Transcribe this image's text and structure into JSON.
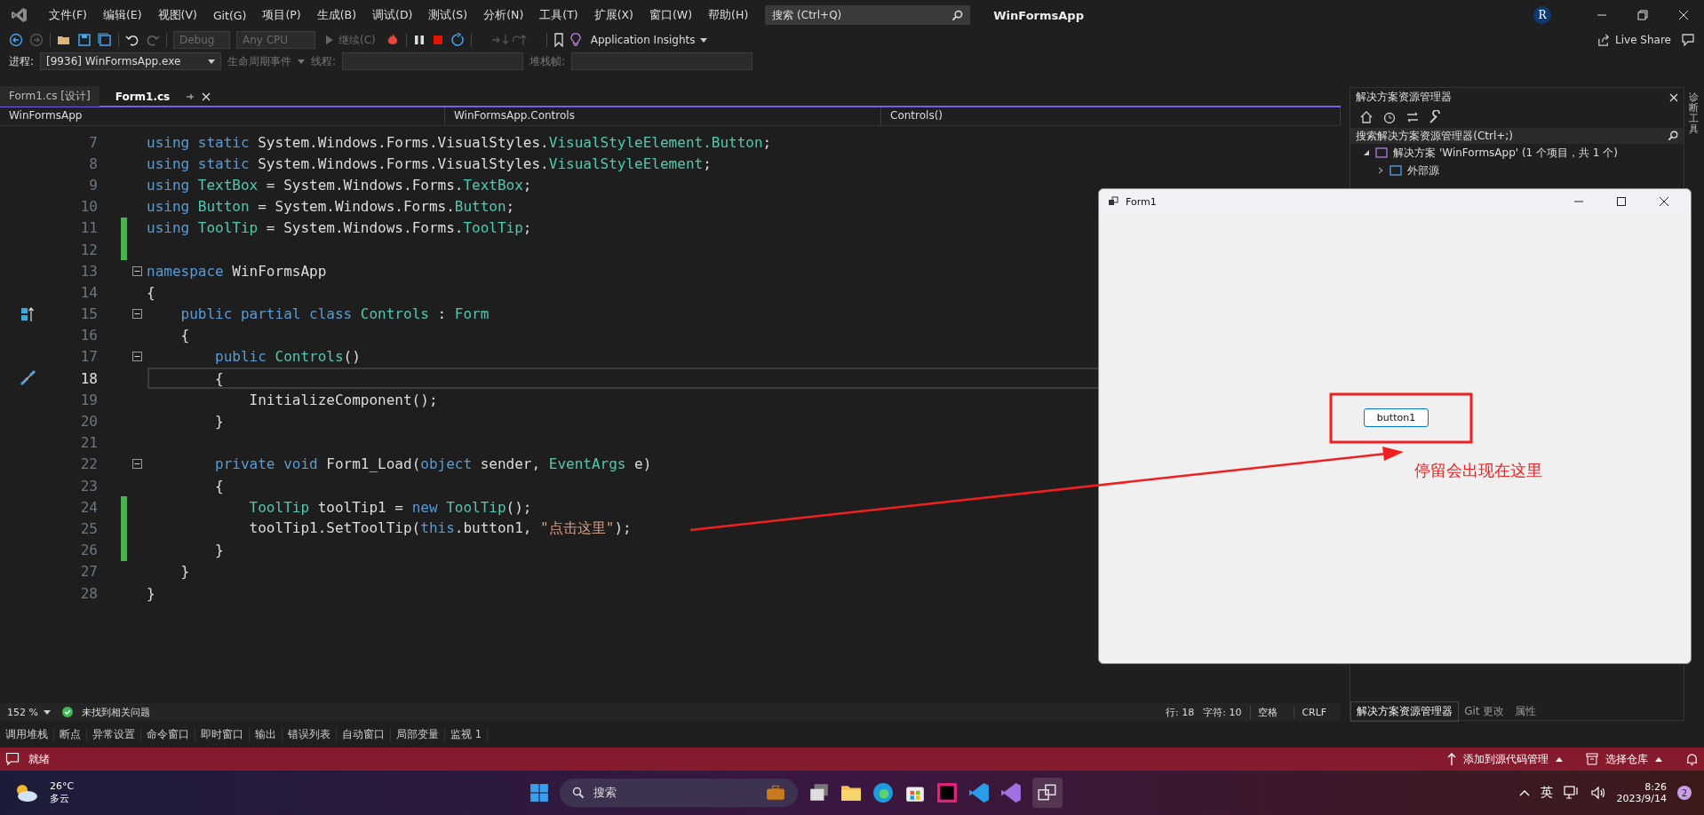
{
  "menu_bar": {
    "items": [
      "文件(F)",
      "编辑(E)",
      "视图(V)",
      "Git(G)",
      "项目(P)",
      "生成(B)",
      "调试(D)",
      "测试(S)",
      "分析(N)",
      "工具(T)",
      "扩展(X)",
      "窗口(W)",
      "帮助(H)"
    ],
    "search": {
      "placeholder": "搜索 (Ctrl+Q)"
    },
    "title": "WinFormsApp",
    "avatar": "R"
  },
  "toolbar": {
    "configuration": "Debug",
    "platform": "Any CPU",
    "continue": "继续(C)",
    "insights": "Application Insights",
    "live_share": "Live Share"
  },
  "debug_toolbar": {
    "process_label": "进程:",
    "process": "[9936] WinFormsApp.exe",
    "lifecycle": "生命周期事件",
    "thread_label": "线程:",
    "stack_label": "堆栈帧:"
  },
  "doc_tabs": [
    {
      "label": "Form1.cs [设计]",
      "selected": false
    },
    {
      "label": "Form1.cs",
      "selected": true
    }
  ],
  "nav_bar": {
    "project": "WinFormsApp",
    "type": "WinFormsApp.Controls",
    "member": "Controls()"
  },
  "code": {
    "lines": [
      {
        "number": "7",
        "changed": false,
        "fold": false,
        "current": false,
        "tokens": [
          {
            "kind": "kw",
            "text": "using static "
          },
          {
            "kind": "plain",
            "text": "System.Windows.Forms.VisualStyles."
          },
          {
            "kind": "type",
            "text": "VisualStyleElement.Button"
          },
          {
            "kind": "plain",
            "text": ";"
          }
        ]
      },
      {
        "number": "8",
        "changed": false,
        "fold": false,
        "current": false,
        "tokens": [
          {
            "kind": "kw",
            "text": "using static "
          },
          {
            "kind": "plain",
            "text": "System.Windows.Forms.VisualStyles."
          },
          {
            "kind": "type",
            "text": "VisualStyleElement"
          },
          {
            "kind": "plain",
            "text": ";"
          }
        ]
      },
      {
        "number": "9",
        "changed": false,
        "fold": false,
        "current": false,
        "tokens": [
          {
            "kind": "kw",
            "text": "using "
          },
          {
            "kind": "type",
            "text": "TextBox"
          },
          {
            "kind": "plain",
            "text": " = System.Windows.Forms."
          },
          {
            "kind": "type",
            "text": "TextBox"
          },
          {
            "kind": "plain",
            "text": ";"
          }
        ]
      },
      {
        "number": "10",
        "changed": false,
        "fold": false,
        "current": false,
        "tokens": [
          {
            "kind": "kw",
            "text": "using "
          },
          {
            "kind": "type",
            "text": "Button"
          },
          {
            "kind": "plain",
            "text": " = System.Windows.Forms."
          },
          {
            "kind": "type",
            "text": "Button"
          },
          {
            "kind": "plain",
            "text": ";"
          }
        ]
      },
      {
        "number": "11",
        "changed": true,
        "fold": false,
        "current": false,
        "tokens": [
          {
            "kind": "kw",
            "text": "using "
          },
          {
            "kind": "type",
            "text": "ToolTip"
          },
          {
            "kind": "plain",
            "text": " = System.Windows.Forms."
          },
          {
            "kind": "type",
            "text": "ToolTip"
          },
          {
            "kind": "plain",
            "text": ";"
          }
        ]
      },
      {
        "number": "12",
        "changed": true,
        "fold": false,
        "current": false
      },
      {
        "number": "13",
        "changed": false,
        "fold": true,
        "current": false,
        "tokens": [
          {
            "kind": "kw",
            "text": "namespace"
          },
          {
            "kind": "plain",
            "text": " WinFormsApp"
          }
        ]
      },
      {
        "number": "14",
        "changed": false,
        "fold": false,
        "current": false,
        "tokens": [
          {
            "kind": "plain",
            "text": "{"
          }
        ]
      },
      {
        "number": "15",
        "changed": false,
        "fold": true,
        "current": false,
        "inheritance_mark": true,
        "tokens": [
          {
            "kind": "kw",
            "text": "    public partial class "
          },
          {
            "kind": "type",
            "text": "Controls"
          },
          {
            "kind": "plain",
            "text": " : "
          },
          {
            "kind": "type",
            "text": "Form"
          }
        ]
      },
      {
        "number": "16",
        "changed": false,
        "fold": false,
        "current": false,
        "tokens": [
          {
            "kind": "plain",
            "text": "    {"
          }
        ]
      },
      {
        "number": "17",
        "changed": false,
        "fold": true,
        "current": false,
        "tokens": [
          {
            "kind": "kw",
            "text": "        public "
          },
          {
            "kind": "type",
            "text": "Controls"
          },
          {
            "kind": "plain",
            "text": "()"
          }
        ]
      },
      {
        "number": "18",
        "changed": false,
        "fold": false,
        "current": true,
        "quick_action_mark": true,
        "tokens": [
          {
            "kind": "plain",
            "text": "        {"
          }
        ]
      },
      {
        "number": "19",
        "changed": false,
        "fold": false,
        "current": false,
        "tokens": [
          {
            "kind": "plain",
            "text": "            InitializeComponent();"
          }
        ]
      },
      {
        "number": "20",
        "changed": false,
        "fold": false,
        "current": false,
        "tokens": [
          {
            "kind": "plain",
            "text": "        }"
          }
        ]
      },
      {
        "number": "21",
        "changed": false,
        "fold": false,
        "current": false
      },
      {
        "number": "22",
        "changed": false,
        "fold": true,
        "current": false,
        "tokens": [
          {
            "kind": "kw",
            "text": "        private void "
          },
          {
            "kind": "plain",
            "text": "Form1_Load("
          },
          {
            "kind": "kw",
            "text": "object"
          },
          {
            "kind": "plain",
            "text": " sender, "
          },
          {
            "kind": "type",
            "text": "EventArgs"
          },
          {
            "kind": "plain",
            "text": " e)"
          }
        ]
      },
      {
        "number": "23",
        "changed": false,
        "fold": false,
        "current": false,
        "tokens": [
          {
            "kind": "plain",
            "text": "        {"
          }
        ]
      },
      {
        "number": "24",
        "changed": true,
        "fold": false,
        "current": false,
        "tokens": [
          {
            "kind": "type",
            "text": "            ToolTip"
          },
          {
            "kind": "plain",
            "text": " toolTip1 = "
          },
          {
            "kind": "kw",
            "text": "new "
          },
          {
            "kind": "type",
            "text": "ToolTip"
          },
          {
            "kind": "plain",
            "text": "();"
          }
        ]
      },
      {
        "number": "25",
        "changed": true,
        "fold": false,
        "current": false,
        "tokens": [
          {
            "kind": "plain",
            "text": "            toolTip1.SetToolTip("
          },
          {
            "kind": "kw",
            "text": "this"
          },
          {
            "kind": "plain",
            "text": ".button1, "
          },
          {
            "kind": "str",
            "text": "\"点击这里\""
          },
          {
            "kind": "plain",
            "text": ");"
          }
        ]
      },
      {
        "number": "26",
        "changed": true,
        "fold": false,
        "current": false,
        "tokens": [
          {
            "kind": "plain",
            "text": "        }"
          }
        ]
      },
      {
        "number": "27",
        "changed": false,
        "fold": false,
        "current": false,
        "tokens": [
          {
            "kind": "plain",
            "text": "    }"
          }
        ]
      },
      {
        "number": "28",
        "changed": false,
        "fold": false,
        "current": false,
        "tokens": [
          {
            "kind": "plain",
            "text": "}"
          }
        ]
      }
    ]
  },
  "editor_status": {
    "zoom": "152 %",
    "issues": "未找到相关问题",
    "line": "行: 18",
    "column": "字符: 10",
    "whitespace": "空格",
    "line_ending": "CRLF"
  },
  "solution_explorer": {
    "title": "解决方案资源管理器",
    "search": {
      "placeholder": "搜索解决方案资源管理器(Ctrl+;)"
    },
    "tree": [
      {
        "label": "解决方案 'WinFormsApp' (1 个项目，共 1 个)",
        "expanded": true,
        "children": [
          {
            "label": "外部源",
            "expanded": false
          }
        ]
      }
    ],
    "tabs": [
      {
        "label": "解决方案资源管理器",
        "selected": true
      },
      {
        "label": "Git 更改",
        "selected": false
      },
      {
        "label": "属性",
        "selected": false
      }
    ]
  },
  "side_strip": {
    "label": "诊断工具"
  },
  "tool_tabs": [
    "调用堆栈",
    "断点",
    "异常设置",
    "命令窗口",
    "即时窗口",
    "输出",
    "错误列表",
    "自动窗口",
    "局部变量",
    "监视 1"
  ],
  "status_bar": {
    "state": "就绪",
    "source_control": "添加到源代码管理",
    "repository": "选择仓库"
  },
  "form_window": {
    "title": "Form1",
    "button": "button1"
  },
  "annotation": {
    "text": "停留会出现在这里"
  },
  "taskbar": {
    "temperature": "26°C",
    "weather": "多云",
    "search": {
      "placeholder": "搜索"
    },
    "input_method": "英",
    "time": "8:26",
    "date": "2023/9/14",
    "notifications": "2"
  }
}
